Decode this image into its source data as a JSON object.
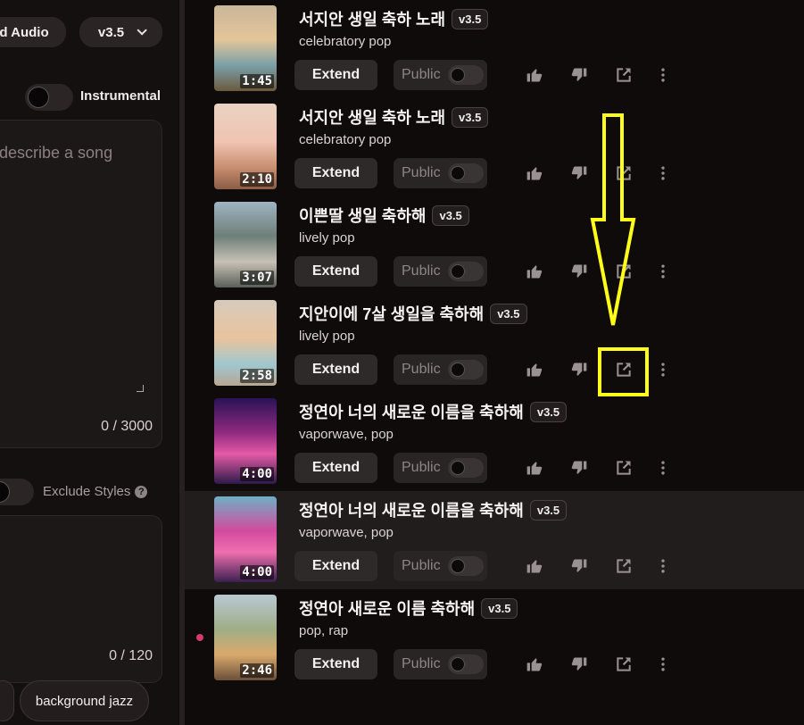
{
  "left_panel": {
    "audio_button": "d Audio",
    "version_select": "v3.5",
    "instrumental_label": "Instrumental",
    "lyrics_placeholder": "describe a song",
    "lyrics_counter": "0 / 3000",
    "exclude_styles_label": "Exclude Styles",
    "styles_counter": "0 / 120",
    "style_chips": [
      "",
      "background jazz"
    ]
  },
  "songs": [
    {
      "title": "서지안 생일 축하 노래",
      "version": "v3.5",
      "genre": "celebratory pop",
      "duration": "1:45",
      "extend": "Extend",
      "public": "Public"
    },
    {
      "title": "서지안 생일 축하 노래",
      "version": "v3.5",
      "genre": "celebratory pop",
      "duration": "2:10",
      "extend": "Extend",
      "public": "Public"
    },
    {
      "title": "이쁜딸 생일 축하해",
      "version": "v3.5",
      "genre": "lively pop",
      "duration": "3:07",
      "extend": "Extend",
      "public": "Public"
    },
    {
      "title": "지안이에 7살 생일을 축하해",
      "version": "v3.5",
      "genre": "lively pop",
      "duration": "2:58",
      "extend": "Extend",
      "public": "Public"
    },
    {
      "title": "정연아 너의 새로운 이름을 축하해",
      "version": "v3.5",
      "genre": "vaporwave, pop",
      "duration": "4:00",
      "extend": "Extend",
      "public": "Public"
    },
    {
      "title": "정연아 너의 새로운 이름을 축하해",
      "version": "v3.5",
      "genre": "vaporwave, pop",
      "duration": "4:00",
      "extend": "Extend",
      "public": "Public"
    },
    {
      "title": "정연아 새로운 이름 축하해",
      "version": "v3.5",
      "genre": "pop, rap",
      "duration": "2:46",
      "extend": "Extend",
      "public": "Public"
    }
  ],
  "icons": {
    "like": "thumbs-up-icon",
    "dislike": "thumbs-down-icon",
    "share": "share-icon",
    "more": "more-vertical-icon"
  },
  "annotation": {
    "highlight_color": "#ffff1a",
    "target": "share-icon (row 4)"
  }
}
